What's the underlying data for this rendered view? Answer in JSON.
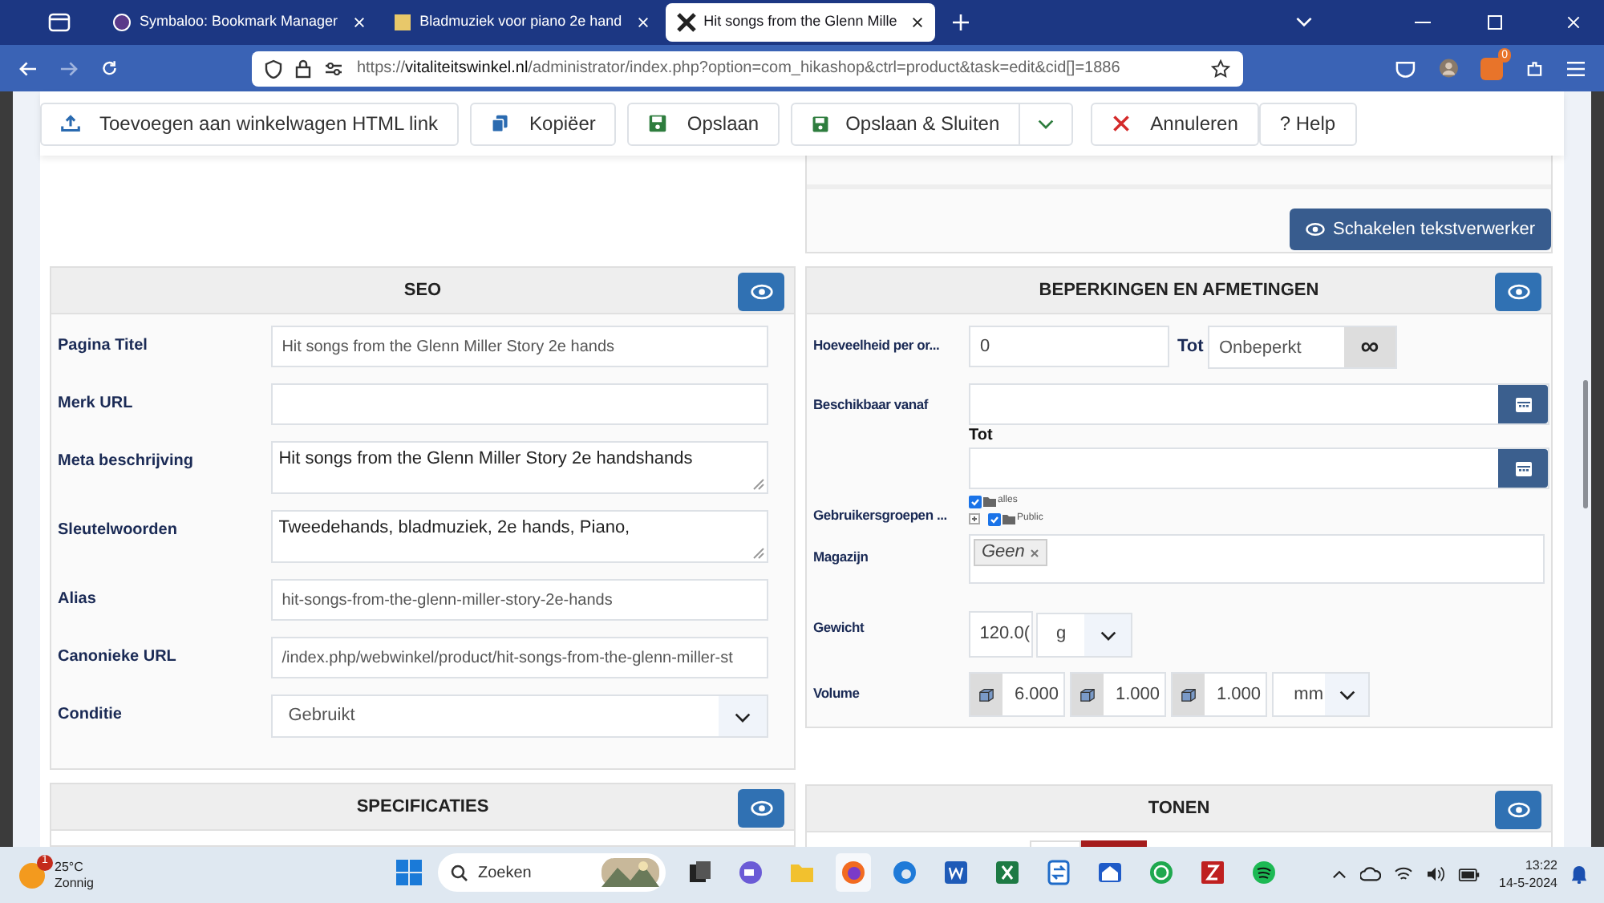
{
  "browser": {
    "tabs": [
      {
        "title": "Symbaloo: Bookmark Manager",
        "selected": false
      },
      {
        "title": "Bladmuziek voor piano 2e hand",
        "selected": false
      },
      {
        "title": "Hit songs from the Glenn Mille",
        "selected": true
      }
    ],
    "url_prefix": "https://",
    "url_domain": "vitaliteitswinkel.nl",
    "url_path": "/administrator/index.php?option=com_hikashop&ctrl=product&task=edit&cid[]=1886",
    "extension_badge": "0"
  },
  "toolbar": {
    "buttons": [
      {
        "label": "Toevoegen aan winkelwagen HTML link",
        "kind": "upload"
      },
      {
        "label": "Kopiëer",
        "kind": "copy"
      },
      {
        "label": "Opslaan",
        "kind": "save"
      },
      {
        "label": "Opslaan & Sluiten",
        "kind": "save-split"
      },
      {
        "label": "Annuleren",
        "kind": "cancel"
      },
      {
        "label": "? Help",
        "kind": "plain"
      }
    ]
  },
  "editor_toggle_button": "Schakelen tekstverwerker",
  "seo": {
    "title": "SEO",
    "fields": [
      {
        "label": "Pagina Titel",
        "value": "Hit songs from the Glenn Miller Story 2e hands",
        "kind": "input"
      },
      {
        "label": "Merk URL",
        "kind": "input"
      },
      {
        "label": "Meta beschrijving",
        "value": "Hit songs from the Glenn Miller Story 2e handshands",
        "kind": "textarea"
      },
      {
        "label": "Sleutelwoorden",
        "value": "Tweedehands, bladmuziek, 2e hands, Piano,",
        "kind": "textarea"
      },
      {
        "label": "Alias",
        "value": "hit-songs-from-the-glenn-miller-story-2e-hands",
        "kind": "input"
      },
      {
        "label": "Canonieke URL",
        "value": "/index.php/webwinkel/product/hit-songs-from-the-glenn-miller-st",
        "kind": "input"
      },
      {
        "label": "Conditie",
        "value": "Gebruikt",
        "kind": "select"
      }
    ]
  },
  "restrictions": {
    "title": "BEPERKINGEN EN AFMETINGEN",
    "quantity": {
      "label": "Hoeveelheid per or...",
      "value": "0",
      "to_label": "Tot",
      "to_placeholder": "Onbeperkt",
      "infinity": "∞"
    },
    "available": {
      "label": "Beschikbaar vanaf",
      "to_label": "Tot"
    },
    "user_groups": {
      "label": "Gebruikersgroepen ...",
      "items": [
        {
          "label": "alles",
          "checked": true,
          "children": [
            {
              "label": "Public",
              "checked": true
            }
          ]
        }
      ]
    },
    "warehouse": {
      "label": "Magazijn",
      "tags": [
        "Geen"
      ]
    },
    "weight": {
      "label": "Gewicht",
      "value": "120.0(",
      "unit": "g"
    },
    "volume": {
      "label": "Volume",
      "values": [
        "6.000",
        "1.000",
        "1.000"
      ],
      "unit": "mm"
    }
  },
  "bottom_panels": [
    {
      "title": "SPECIFICATIES"
    },
    {
      "title": "TONEN"
    }
  ],
  "taskbar": {
    "weather_badge": "1",
    "temperature": "25°C",
    "condition": "Zonnig",
    "search_placeholder": "Zoeken",
    "time": "13:22",
    "date": "14-5-2024"
  }
}
